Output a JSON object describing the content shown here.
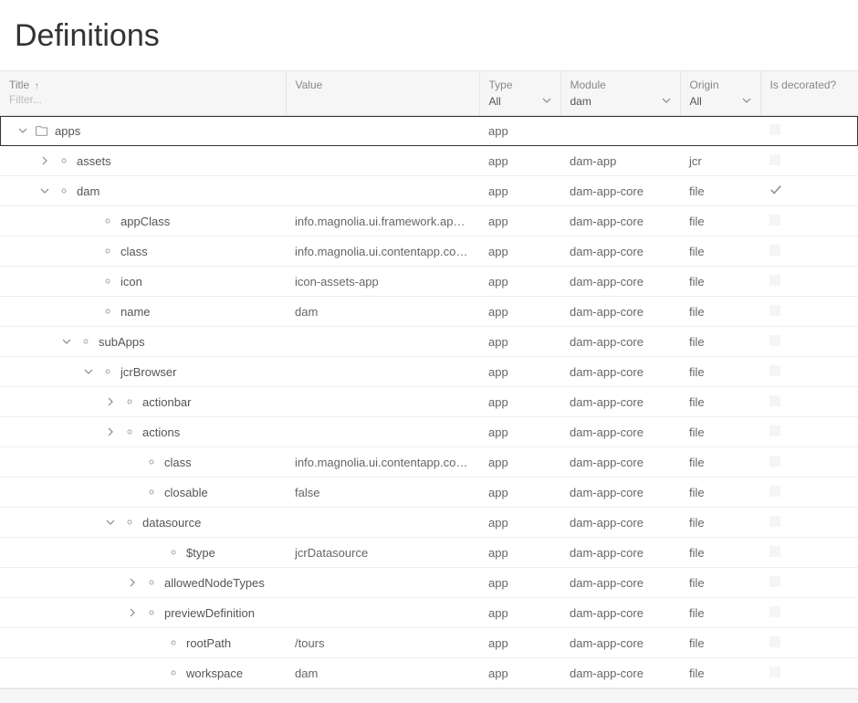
{
  "page_title": "Definitions",
  "columns": {
    "title": {
      "label": "Title",
      "filter_placeholder": "Filter..."
    },
    "value": {
      "label": "Value"
    },
    "type": {
      "label": "Type",
      "selected": "All"
    },
    "module": {
      "label": "Module",
      "selected": "dam"
    },
    "origin": {
      "label": "Origin",
      "selected": "All"
    },
    "decorated": {
      "label": "Is decorated?"
    }
  },
  "rows": [
    {
      "indent": 0,
      "toggle": "down",
      "icon": "folder",
      "title": "apps",
      "value": "",
      "type": "app",
      "module": "",
      "origin": "",
      "decorated": "box",
      "selected": true
    },
    {
      "indent": 1,
      "toggle": "right",
      "icon": "property",
      "title": "assets",
      "value": "",
      "type": "app",
      "module": "dam-app",
      "origin": "jcr",
      "decorated": "box"
    },
    {
      "indent": 1,
      "toggle": "down",
      "icon": "property",
      "title": "dam",
      "value": "",
      "type": "app",
      "module": "dam-app-core",
      "origin": "file",
      "decorated": "check"
    },
    {
      "indent": 3,
      "toggle": "none",
      "icon": "property",
      "title": "appClass",
      "value": "info.magnolia.ui.framework.app.Base",
      "type": "app",
      "module": "dam-app-core",
      "origin": "file",
      "decorated": "box"
    },
    {
      "indent": 3,
      "toggle": "none",
      "icon": "property",
      "title": "class",
      "value": "info.magnolia.ui.contentapp.configura",
      "type": "app",
      "module": "dam-app-core",
      "origin": "file",
      "decorated": "box"
    },
    {
      "indent": 3,
      "toggle": "none",
      "icon": "property",
      "title": "icon",
      "value": "icon-assets-app",
      "type": "app",
      "module": "dam-app-core",
      "origin": "file",
      "decorated": "box"
    },
    {
      "indent": 3,
      "toggle": "none",
      "icon": "property",
      "title": "name",
      "value": "dam",
      "type": "app",
      "module": "dam-app-core",
      "origin": "file",
      "decorated": "box"
    },
    {
      "indent": 2,
      "toggle": "down",
      "icon": "property",
      "title": "subApps",
      "value": "",
      "type": "app",
      "module": "dam-app-core",
      "origin": "file",
      "decorated": "box"
    },
    {
      "indent": 3,
      "toggle": "down",
      "icon": "property",
      "title": "jcrBrowser",
      "value": "",
      "type": "app",
      "module": "dam-app-core",
      "origin": "file",
      "decorated": "box"
    },
    {
      "indent": 4,
      "toggle": "right",
      "icon": "property",
      "title": "actionbar",
      "value": "",
      "type": "app",
      "module": "dam-app-core",
      "origin": "file",
      "decorated": "box"
    },
    {
      "indent": 4,
      "toggle": "right",
      "icon": "property",
      "title": "actions",
      "value": "",
      "type": "app",
      "module": "dam-app-core",
      "origin": "file",
      "decorated": "box"
    },
    {
      "indent": 5,
      "toggle": "none",
      "icon": "property",
      "title": "class",
      "value": "info.magnolia.ui.contentapp.configura",
      "type": "app",
      "module": "dam-app-core",
      "origin": "file",
      "decorated": "box"
    },
    {
      "indent": 5,
      "toggle": "none",
      "icon": "property",
      "title": "closable",
      "value": "false",
      "type": "app",
      "module": "dam-app-core",
      "origin": "file",
      "decorated": "box"
    },
    {
      "indent": 4,
      "toggle": "down",
      "icon": "property",
      "title": "datasource",
      "value": "",
      "type": "app",
      "module": "dam-app-core",
      "origin": "file",
      "decorated": "box"
    },
    {
      "indent": 6,
      "toggle": "none",
      "icon": "property",
      "title": "$type",
      "value": "jcrDatasource",
      "type": "app",
      "module": "dam-app-core",
      "origin": "file",
      "decorated": "box"
    },
    {
      "indent": 5,
      "toggle": "right",
      "icon": "property",
      "title": "allowedNodeTypes",
      "value": "",
      "type": "app",
      "module": "dam-app-core",
      "origin": "file",
      "decorated": "box"
    },
    {
      "indent": 5,
      "toggle": "right",
      "icon": "property",
      "title": "previewDefinition",
      "value": "",
      "type": "app",
      "module": "dam-app-core",
      "origin": "file",
      "decorated": "box"
    },
    {
      "indent": 6,
      "toggle": "none",
      "icon": "property",
      "title": "rootPath",
      "value": "/tours",
      "type": "app",
      "module": "dam-app-core",
      "origin": "file",
      "decorated": "box"
    },
    {
      "indent": 6,
      "toggle": "none",
      "icon": "property",
      "title": "workspace",
      "value": "dam",
      "type": "app",
      "module": "dam-app-core",
      "origin": "file",
      "decorated": "box"
    }
  ]
}
